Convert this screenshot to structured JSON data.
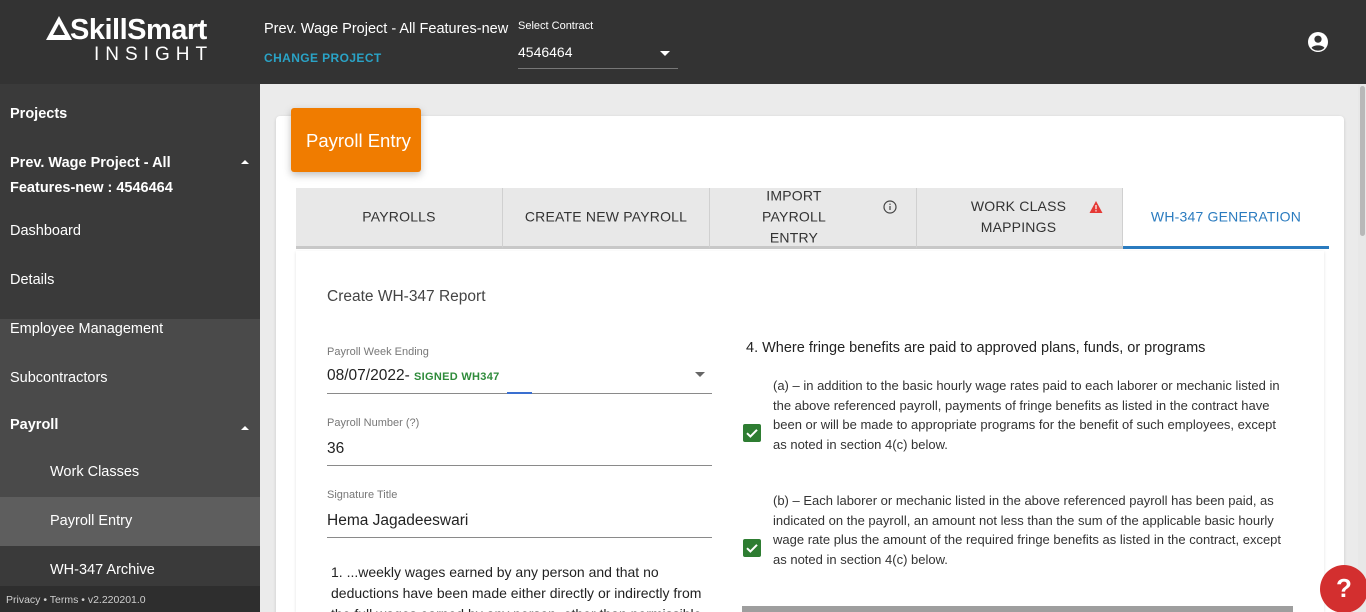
{
  "brand": {
    "name": "SkillSmart",
    "sub": "INSIGHT"
  },
  "header": {
    "project_title": "Prev. Wage Project - All Features-new",
    "change_project": "CHANGE PROJECT",
    "contract_label": "Select Contract",
    "contract_value": "4546464",
    "account_icon": "account-circle-icon"
  },
  "sidebar": {
    "items": [
      {
        "label": "Projects"
      },
      {
        "label": "Prev. Wage Project - All Features-new : 4546464"
      },
      {
        "label": "Dashboard"
      },
      {
        "label": "Details"
      },
      {
        "label": "Employee Management"
      },
      {
        "label": "Subcontractors"
      },
      {
        "label": "Payroll"
      },
      {
        "label": "Work Classes"
      },
      {
        "label": "Payroll Entry"
      },
      {
        "label": "WH-347 Archive"
      }
    ],
    "footer": "Privacy • Terms • v2.220201.0"
  },
  "page": {
    "header": "Payroll Entry",
    "tabs": [
      {
        "label": "PAYROLLS"
      },
      {
        "label": "CREATE NEW PAYROLL"
      },
      {
        "label": "IMPORT PAYROLL ENTRY",
        "icon": "info-icon"
      },
      {
        "label": "WORK CLASS MAPPINGS",
        "icon": "warning-icon"
      },
      {
        "label": "WH-347 GENERATION",
        "active": true
      }
    ],
    "section_title": "Create WH-347 Report",
    "form": {
      "week_ending_label": "Payroll Week Ending",
      "week_ending_value": "08/07/2022",
      "week_ending_separator": "- ",
      "week_ending_status": "SIGNED WH347",
      "payroll_number_label": "Payroll Number (?)",
      "payroll_number_value": "36",
      "signature_title_label": "Signature Title",
      "signature_title_value": "Hema Jagadeeswari"
    },
    "statement1": "1. ...weekly wages earned by any person and that no deductions have been made either directly or indirectly from the full wages earned by any person, other than permissible",
    "fringe": {
      "title": "4. Where fringe benefits are paid to approved plans, funds, or programs",
      "option_a": "(a) – in addition to the basic hourly wage rates paid to each laborer or mechanic listed in the above referenced payroll, payments of fringe benefits as listed in the contract have been or will be made to appropriate programs for the benefit of such employees, except as noted in section 4(c) below.",
      "option_a_checked": true,
      "option_b": "(b) – Each laborer or mechanic listed in the above referenced payroll has been paid, as indicated on the payroll, an amount not less than the sum of the applicable basic hourly wage rate plus the amount of the required fringe benefits as listed in the contract, except as noted in section 4(c) below.",
      "option_b_checked": true
    },
    "help_label": "?"
  },
  "colors": {
    "topbar": "#333333",
    "sidebar": "#3a3a3a",
    "accent_orange": "#f07c00",
    "active_tab": "#2a7bbf",
    "checkbox_green": "#2e7d32",
    "help_red": "#d32f2f",
    "link_teal": "#2aa3c6"
  }
}
